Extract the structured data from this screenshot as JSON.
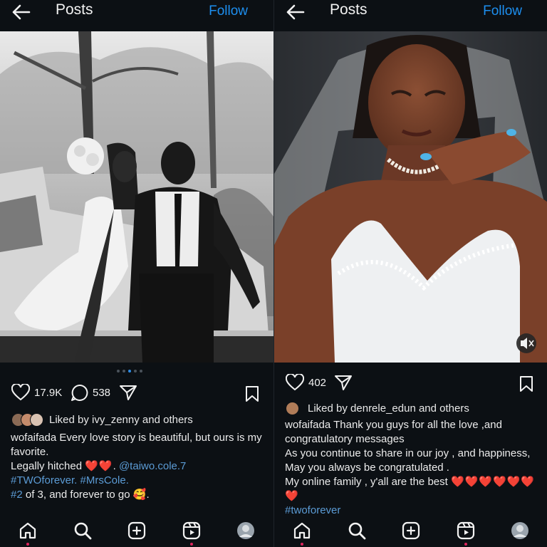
{
  "left": {
    "header": {
      "title": "Posts",
      "follow_label": "Follow"
    },
    "post": {
      "likes_count": "17.9K",
      "comments_count": "538",
      "liked_by": "Liked by ivy_zenny and others",
      "carousel": {
        "count": 5,
        "active": 3
      },
      "caption": {
        "username": "wofaifada",
        "line1": " Every love story is beautiful, but ours is my favorite.",
        "line2_text": "Legally hitched ",
        "line2_hearts": "❤️❤️",
        "line2_sep": ". ",
        "line2_mention": "@taiwo.cole.7",
        "hashtags": "#TWOforever. #MrsCole.",
        "line4_tag": "#2",
        "line4_text": " of 3, and forever to go 🥰."
      }
    }
  },
  "right": {
    "header": {
      "title": "Posts",
      "follow_label": "Follow"
    },
    "post": {
      "likes_count": "402",
      "liked_by": "Liked by denrele_edun and others",
      "caption": {
        "username": "wofaifada",
        "line1": " Thank you guys for all the love ,and congratulatory messages",
        "line2": "As you continue to share in our joy , and happiness,",
        "line3": "May you always be congratulated .",
        "line4": "My online family , y'all are the best ",
        "hearts": "❤️❤️❤️❤️❤️❤️❤️",
        "hashtag": "#twoforever"
      }
    }
  },
  "icons": [
    "back-arrow-icon",
    "heart-icon",
    "comment-icon",
    "share-icon",
    "bookmark-icon",
    "mute-icon",
    "home-icon",
    "search-icon",
    "create-icon",
    "reels-icon",
    "profile-avatar"
  ],
  "colors": {
    "background": "#0c1014",
    "accent": "#1d8ff0",
    "link": "#5b9bd5",
    "heart": "#e63131"
  }
}
